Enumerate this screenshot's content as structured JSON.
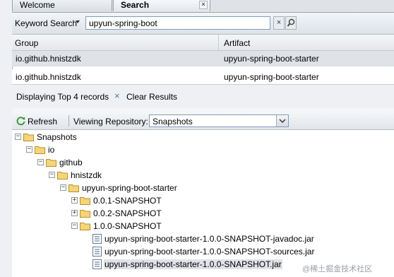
{
  "tabs": [
    {
      "label": "Welcome"
    },
    {
      "label": "Search",
      "close": "×"
    }
  ],
  "search": {
    "label": "Keyword Search",
    "value": "upyun-spring-boot",
    "clear": "×"
  },
  "grid": {
    "columns": [
      "Group",
      "Artifact"
    ],
    "rows": [
      {
        "group": "io.github.hnistzdk",
        "artifact": "upyun-spring-boot-starter"
      },
      {
        "group": "io.github.hnistzdk",
        "artifact": "upyun-spring-boot-starter"
      }
    ]
  },
  "status": {
    "text": "Displaying Top 4 records",
    "clear_icon": "×",
    "clear_label": "Clear Results"
  },
  "browse": {
    "refresh": "Refresh",
    "viewing_label": "Viewing Repository:",
    "repository": "Snapshots"
  },
  "tree": [
    {
      "label": "Snapshots",
      "toggle": "−"
    },
    {
      "label": "io",
      "toggle": "−"
    },
    {
      "label": "github",
      "toggle": "−"
    },
    {
      "label": "hnistzdk",
      "toggle": "−"
    },
    {
      "label": "upyun-spring-boot-starter",
      "toggle": "−"
    },
    {
      "label": "0.0.1-SNAPSHOT",
      "toggle": "+"
    },
    {
      "label": "0.0.2-SNAPSHOT",
      "toggle": "+"
    },
    {
      "label": "1.0.0-SNAPSHOT",
      "toggle": "−"
    },
    {
      "label": "upyun-spring-boot-starter-1.0.0-SNAPSHOT-javadoc.jar"
    },
    {
      "label": "upyun-spring-boot-starter-1.0.0-SNAPSHOT-sources.jar"
    },
    {
      "label": "upyun-spring-boot-starter-1.0.0-SNAPSHOT.jar"
    }
  ],
  "watermark": "@稀土掘金技术社区"
}
